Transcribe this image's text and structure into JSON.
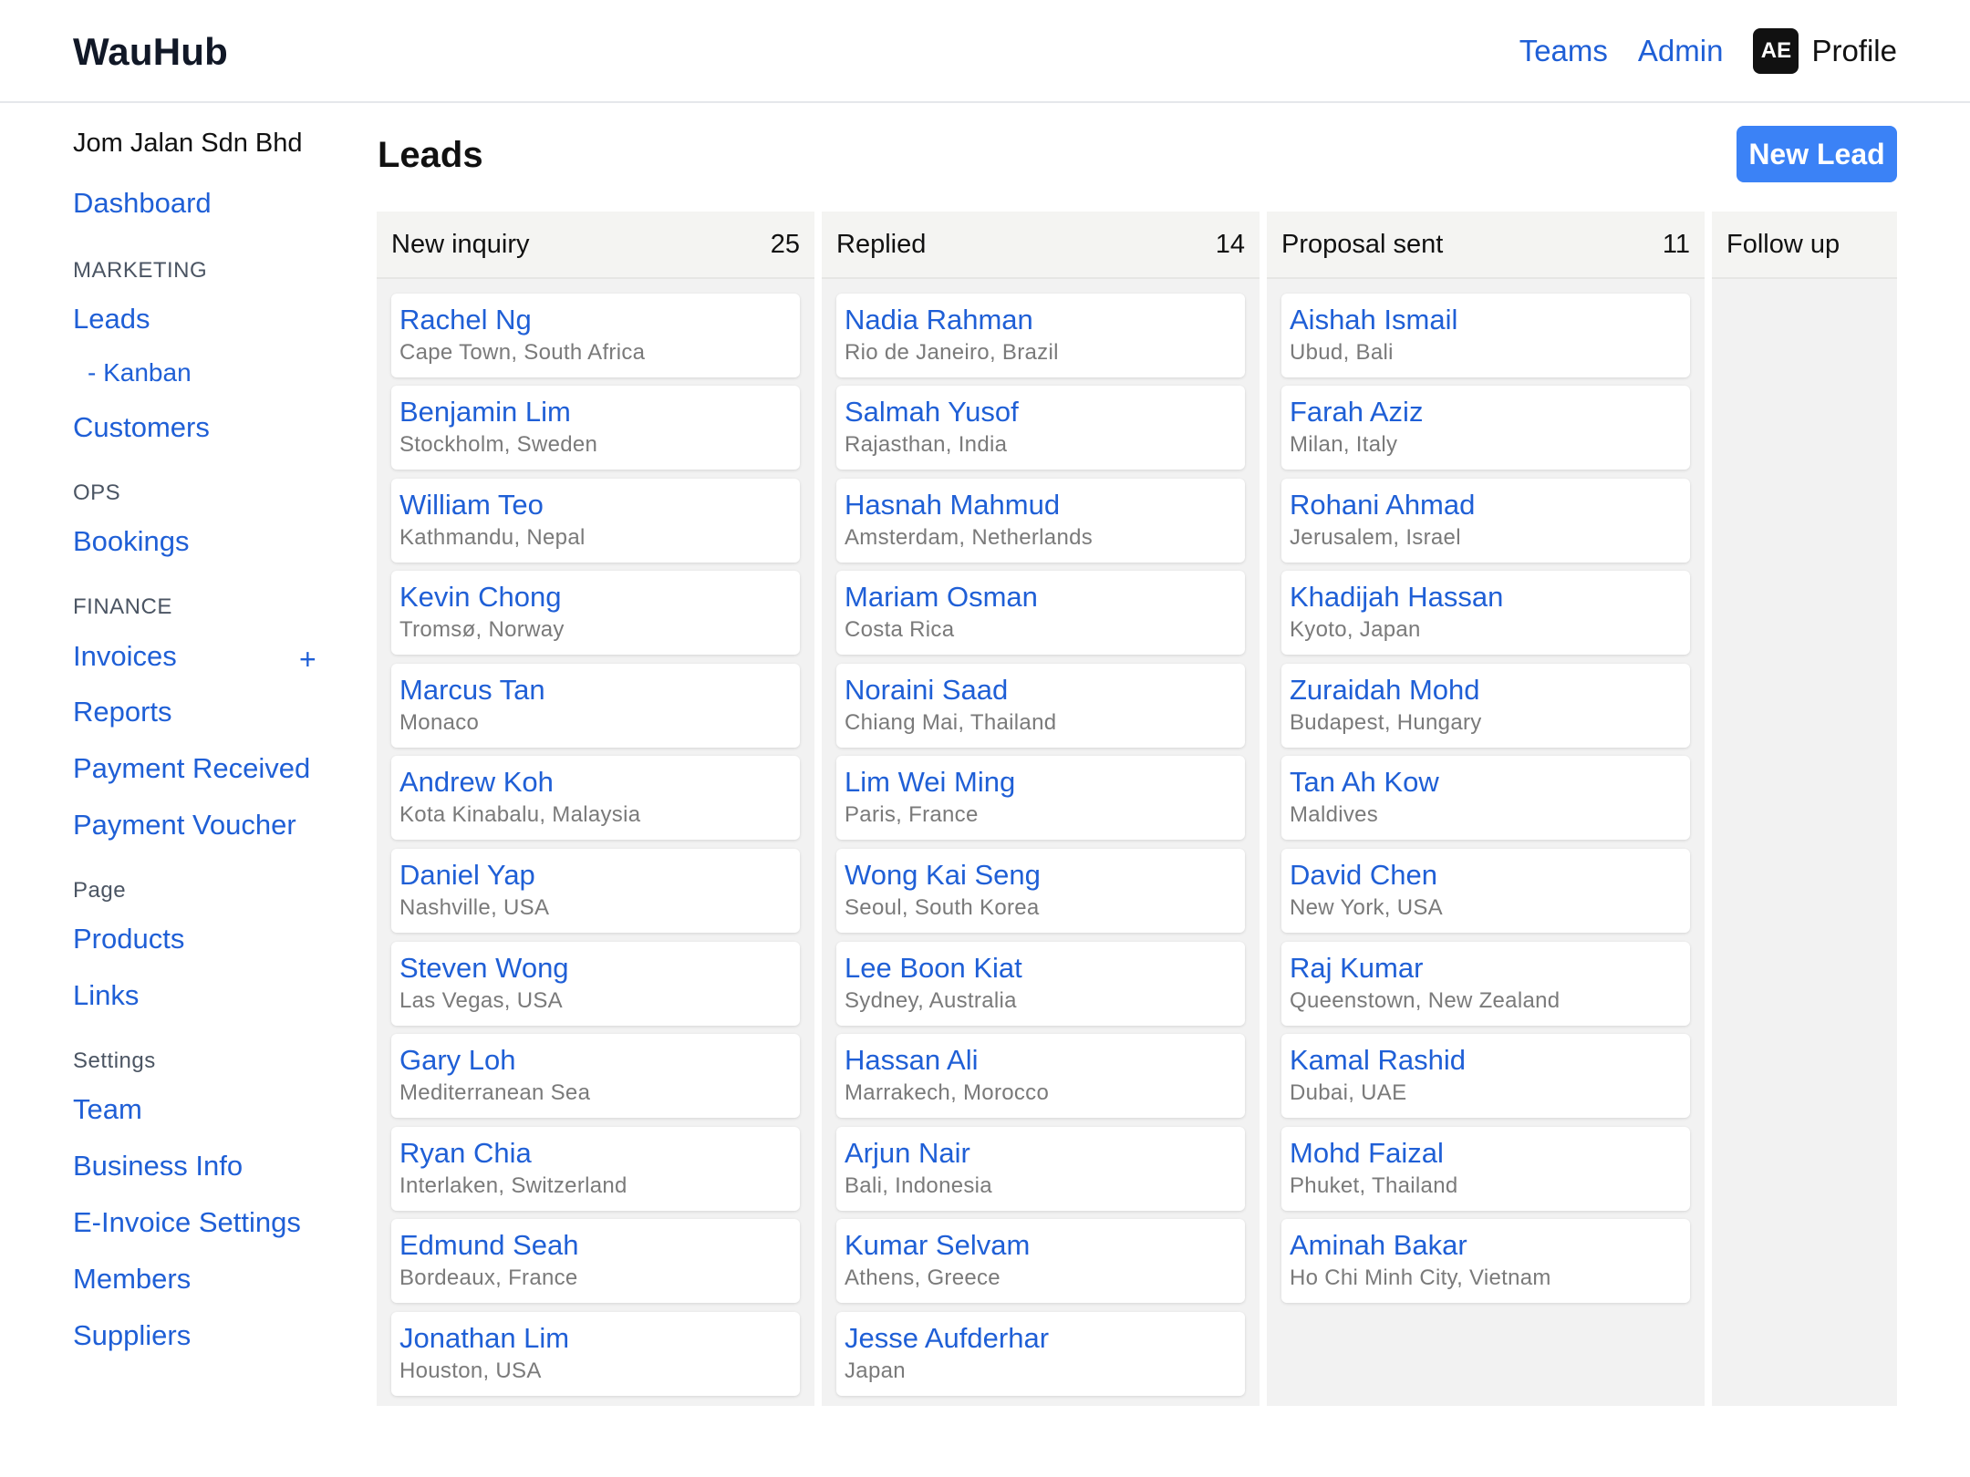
{
  "app": {
    "brand": "WauHub"
  },
  "topnav": {
    "teams": "Teams",
    "admin": "Admin",
    "avatar_initials": "AE",
    "profile": "Profile"
  },
  "sidebar": {
    "org": "Jom Jalan Sdn Bhd",
    "dashboard": "Dashboard",
    "sections": {
      "marketing": "MARKETING",
      "ops": "OPS",
      "finance": "FINANCE",
      "page": "Page",
      "settings": "Settings"
    },
    "items": {
      "leads": "Leads",
      "kanban": "- Kanban",
      "customers": "Customers",
      "bookings": "Bookings",
      "invoices": "Invoices",
      "invoices_add": "+",
      "reports": "Reports",
      "payment_received": "Payment Received",
      "payment_voucher": "Payment Voucher",
      "products": "Products",
      "links": "Links",
      "team": "Team",
      "business_info": "Business Info",
      "einvoice_settings": "E-Invoice Settings",
      "members": "Members",
      "suppliers": "Suppliers"
    }
  },
  "main": {
    "title": "Leads",
    "new_lead": "New Lead"
  },
  "board": {
    "columns": [
      {
        "title": "New inquiry",
        "count": "25",
        "cards": [
          {
            "name": "Rachel Ng",
            "location": "Cape Town, South Africa"
          },
          {
            "name": "Benjamin Lim",
            "location": "Stockholm, Sweden"
          },
          {
            "name": "William Teo",
            "location": "Kathmandu, Nepal"
          },
          {
            "name": "Kevin Chong",
            "location": "Tromsø, Norway"
          },
          {
            "name": "Marcus Tan",
            "location": "Monaco"
          },
          {
            "name": "Andrew Koh",
            "location": "Kota Kinabalu, Malaysia"
          },
          {
            "name": "Daniel Yap",
            "location": "Nashville, USA"
          },
          {
            "name": "Steven Wong",
            "location": "Las Vegas, USA"
          },
          {
            "name": "Gary Loh",
            "location": "Mediterranean Sea"
          },
          {
            "name": "Ryan Chia",
            "location": "Interlaken, Switzerland"
          },
          {
            "name": "Edmund Seah",
            "location": "Bordeaux, France"
          },
          {
            "name": "Jonathan Lim",
            "location": "Houston, USA"
          }
        ]
      },
      {
        "title": "Replied",
        "count": "14",
        "cards": [
          {
            "name": "Nadia Rahman",
            "location": "Rio de Janeiro, Brazil"
          },
          {
            "name": "Salmah Yusof",
            "location": "Rajasthan, India"
          },
          {
            "name": "Hasnah Mahmud",
            "location": "Amsterdam, Netherlands"
          },
          {
            "name": "Mariam Osman",
            "location": "Costa Rica"
          },
          {
            "name": "Noraini Saad",
            "location": "Chiang Mai, Thailand"
          },
          {
            "name": "Lim Wei Ming",
            "location": "Paris, France"
          },
          {
            "name": "Wong Kai Seng",
            "location": "Seoul, South Korea"
          },
          {
            "name": "Lee Boon Kiat",
            "location": "Sydney, Australia"
          },
          {
            "name": "Hassan Ali",
            "location": "Marrakech, Morocco"
          },
          {
            "name": "Arjun Nair",
            "location": "Bali, Indonesia"
          },
          {
            "name": "Kumar Selvam",
            "location": "Athens, Greece"
          },
          {
            "name": "Jesse Aufderhar",
            "location": "Japan"
          }
        ]
      },
      {
        "title": "Proposal sent",
        "count": "11",
        "cards": [
          {
            "name": "Aishah Ismail",
            "location": "Ubud, Bali"
          },
          {
            "name": "Farah Aziz",
            "location": "Milan, Italy"
          },
          {
            "name": "Rohani Ahmad",
            "location": "Jerusalem, Israel"
          },
          {
            "name": "Khadijah Hassan",
            "location": "Kyoto, Japan"
          },
          {
            "name": "Zuraidah Mohd",
            "location": "Budapest, Hungary"
          },
          {
            "name": "Tan Ah Kow",
            "location": "Maldives"
          },
          {
            "name": "David Chen",
            "location": "New York, USA"
          },
          {
            "name": "Raj Kumar",
            "location": "Queenstown, New Zealand"
          },
          {
            "name": "Kamal Rashid",
            "location": "Dubai, UAE"
          },
          {
            "name": "Mohd Faizal",
            "location": "Phuket, Thailand"
          },
          {
            "name": "Aminah Bakar",
            "location": "Ho Chi Minh City, Vietnam"
          }
        ]
      },
      {
        "title": "Follow up",
        "count": "",
        "cards": []
      }
    ]
  }
}
